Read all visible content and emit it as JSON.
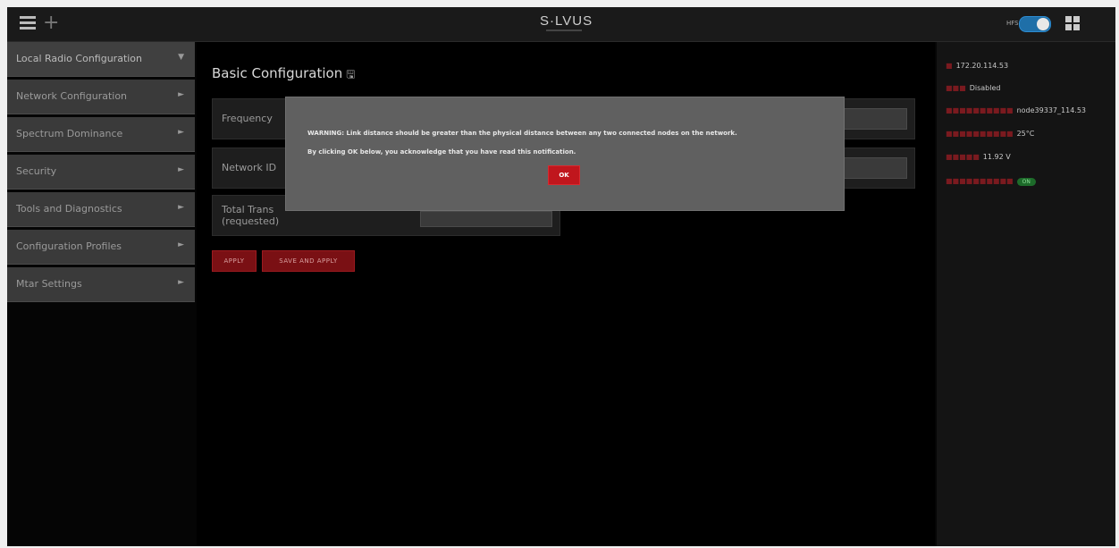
{
  "topbar": {
    "logo": "S·LVUS",
    "toggle_label": "HFS"
  },
  "sidebar": {
    "items": [
      {
        "label": "Local Radio Configuration"
      },
      {
        "label": "Network Configuration"
      },
      {
        "label": "Spectrum Dominance"
      },
      {
        "label": "Security"
      },
      {
        "label": "Tools and Diagnostics"
      },
      {
        "label": "Configuration Profiles"
      },
      {
        "label": "Mtar Settings"
      }
    ]
  },
  "main": {
    "title": "Basic Configuration",
    "rows": [
      {
        "label": "Frequency"
      },
      {
        "label": "Network ID"
      },
      {
        "label": "Total Trans",
        "label2": "(requested)"
      }
    ],
    "apply_label": "APPLY",
    "save_apply_label": "SAVE AND APPLY"
  },
  "status": {
    "ip": "172.20.114.53",
    "gps": "Disabled",
    "node_name": "node39337_114.53",
    "temperature": "25°C",
    "voltage": "11.92 V",
    "status_badge": "ON"
  },
  "modal": {
    "line1": "WARNING: Link distance should be greater than the physical distance between any two connected nodes on the network.",
    "line2": "By clicking OK below, you acknowledge that you have read this notification.",
    "ok_label": "OK"
  }
}
